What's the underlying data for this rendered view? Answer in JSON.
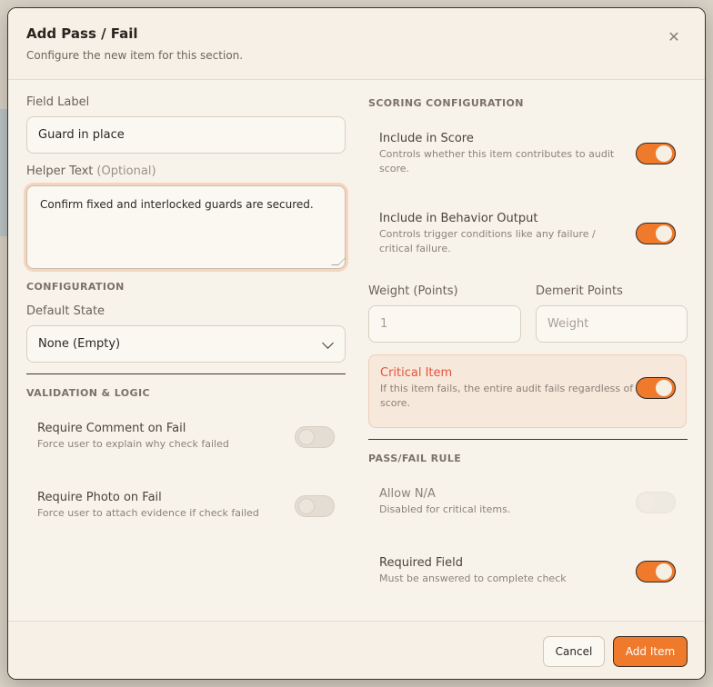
{
  "modal": {
    "title": "Add Pass / Fail",
    "subtitle": "Configure the new item for this section.",
    "close_icon": "close-icon"
  },
  "left": {
    "field_label": {
      "label": "Field Label",
      "value": "Guard in place"
    },
    "helper_text": {
      "label": "Helper Text",
      "optional": "(Optional)",
      "value": "Confirm fixed and interlocked guards are secured."
    },
    "configuration": {
      "heading": "CONFIGURATION",
      "default_state_label": "Default State",
      "default_state_value": "None (Empty)"
    },
    "validation": {
      "heading": "VALIDATION & LOGIC",
      "require_comment": {
        "title": "Require Comment on Fail",
        "desc": "Force user to explain why check failed",
        "on": false
      },
      "require_photo": {
        "title": "Require Photo on Fail",
        "desc": "Force user to attach evidence if check failed",
        "on": false
      }
    }
  },
  "right": {
    "scoring": {
      "heading": "SCORING CONFIGURATION",
      "include_score": {
        "title": "Include in Score",
        "desc": "Controls whether this item contributes to audit score.",
        "on": true
      },
      "include_behavior": {
        "title": "Include in Behavior Output",
        "desc": "Controls trigger conditions like any failure / critical failure.",
        "on": true
      }
    },
    "weight": {
      "label": "Weight (Points)",
      "value": "1"
    },
    "demerit": {
      "label": "Demerit Points",
      "placeholder": "Weight"
    },
    "critical": {
      "title": "Critical Item",
      "desc": "If this item fails, the entire audit fails regardless of score.",
      "on": true
    },
    "rule": {
      "heading": "PASS/FAIL RULE",
      "allow_na": {
        "title": "Allow N/A",
        "desc": "Disabled for critical items.",
        "on": false
      },
      "required": {
        "title": "Required Field",
        "desc": "Must be answered to complete check",
        "on": true
      }
    }
  },
  "footer": {
    "cancel_label": "Cancel",
    "add_label": "Add Item"
  },
  "colors": {
    "accent": "#f07a2c",
    "critical": "#e5533a",
    "background": "#f8f3ea"
  }
}
